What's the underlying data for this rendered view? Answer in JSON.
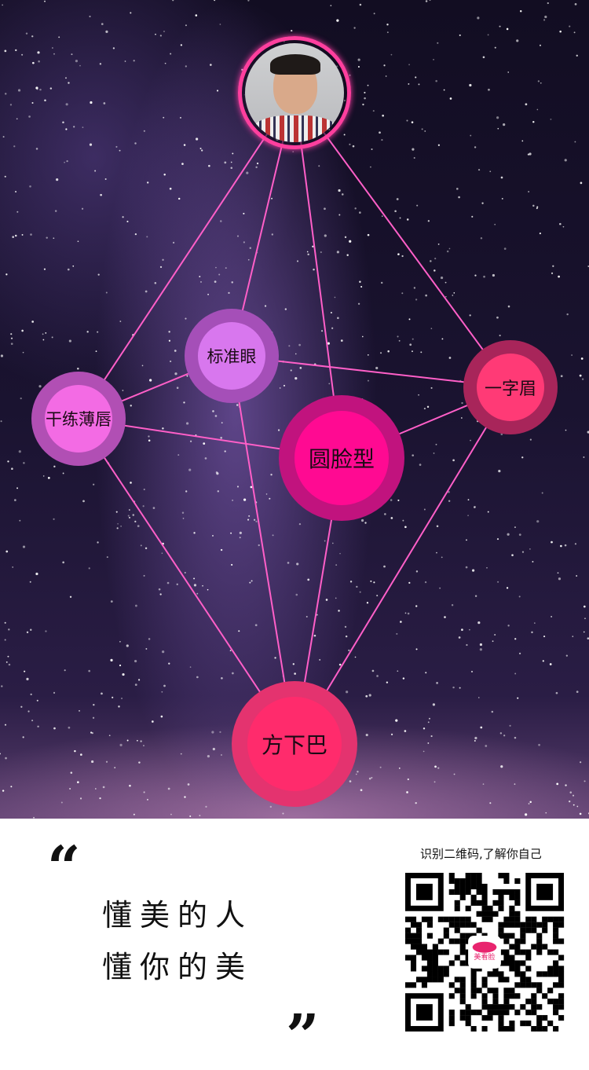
{
  "profile": {
    "avatar_alt": "user photo"
  },
  "graph": {
    "nodes": [
      {
        "id": "biaozhunyan",
        "label": "标准眼",
        "outer": "#a54fb8",
        "inner": "#d877ee"
      },
      {
        "id": "ganlianbochun",
        "label": "干练薄唇",
        "outer": "#b14fb4",
        "inner": "#f36be4"
      },
      {
        "id": "yuanlianxing",
        "label": "圆脸型",
        "outer": "#c1137e",
        "inner": "#ff0a92"
      },
      {
        "id": "yizimei",
        "label": "一字眉",
        "outer": "#a8255a",
        "inner": "#ff3a76"
      },
      {
        "id": "fangxiaba",
        "label": "方下巴",
        "outer": "#e4336f",
        "inner": "#ff2b6c"
      }
    ],
    "edges": [
      [
        "avatar",
        "ganlianbochun"
      ],
      [
        "avatar",
        "biaozhunyan"
      ],
      [
        "avatar",
        "yuanlianxing"
      ],
      [
        "avatar",
        "yizimei"
      ],
      [
        "biaozhunyan",
        "yizimei"
      ],
      [
        "biaozhunyan",
        "ganlianbochun"
      ],
      [
        "biaozhunyan",
        "fangxiaba"
      ],
      [
        "ganlianbochun",
        "yuanlianxing"
      ],
      [
        "ganlianbochun",
        "fangxiaba"
      ],
      [
        "yuanlianxing",
        "yizimei"
      ],
      [
        "yuanlianxing",
        "fangxiaba"
      ],
      [
        "yizimei",
        "fangxiaba"
      ]
    ],
    "edge_color": "#ff5fc8"
  },
  "footer": {
    "open_quote": "“",
    "close_quote": "”",
    "slogan_line1": "懂美的人",
    "slogan_line2": "懂你的美",
    "qr_caption": "识别二维码,了解你自己",
    "qr_logo_text": "美看脸",
    "brand_color": "#e8246e"
  }
}
